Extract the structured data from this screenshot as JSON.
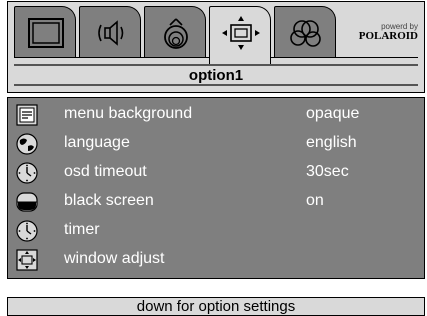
{
  "brand": {
    "powered_by": "powerd by",
    "name": "POLAROID"
  },
  "tabs": [
    {
      "icon": "picture-icon",
      "active": false
    },
    {
      "icon": "audio-icon",
      "active": false
    },
    {
      "icon": "color-icon",
      "active": false
    },
    {
      "icon": "window-adjust-icon",
      "active": true
    },
    {
      "icon": "multi-circle-icon",
      "active": false
    }
  ],
  "page": {
    "title": "option1"
  },
  "menu": {
    "items": [
      {
        "label": "menu background",
        "value": "opaque",
        "icon": "menu-background-icon"
      },
      {
        "label": "language",
        "value": "english",
        "icon": "globe-icon"
      },
      {
        "label": "osd timeout",
        "value": "30sec",
        "icon": "clock-icon"
      },
      {
        "label": "black screen",
        "value": "on",
        "icon": "black-screen-icon"
      },
      {
        "label": "timer",
        "value": "",
        "icon": "clock-icon"
      },
      {
        "label": "window adjust",
        "value": "",
        "icon": "window-adjust-icon"
      }
    ]
  },
  "footer": {
    "hint": "down for option settings"
  }
}
